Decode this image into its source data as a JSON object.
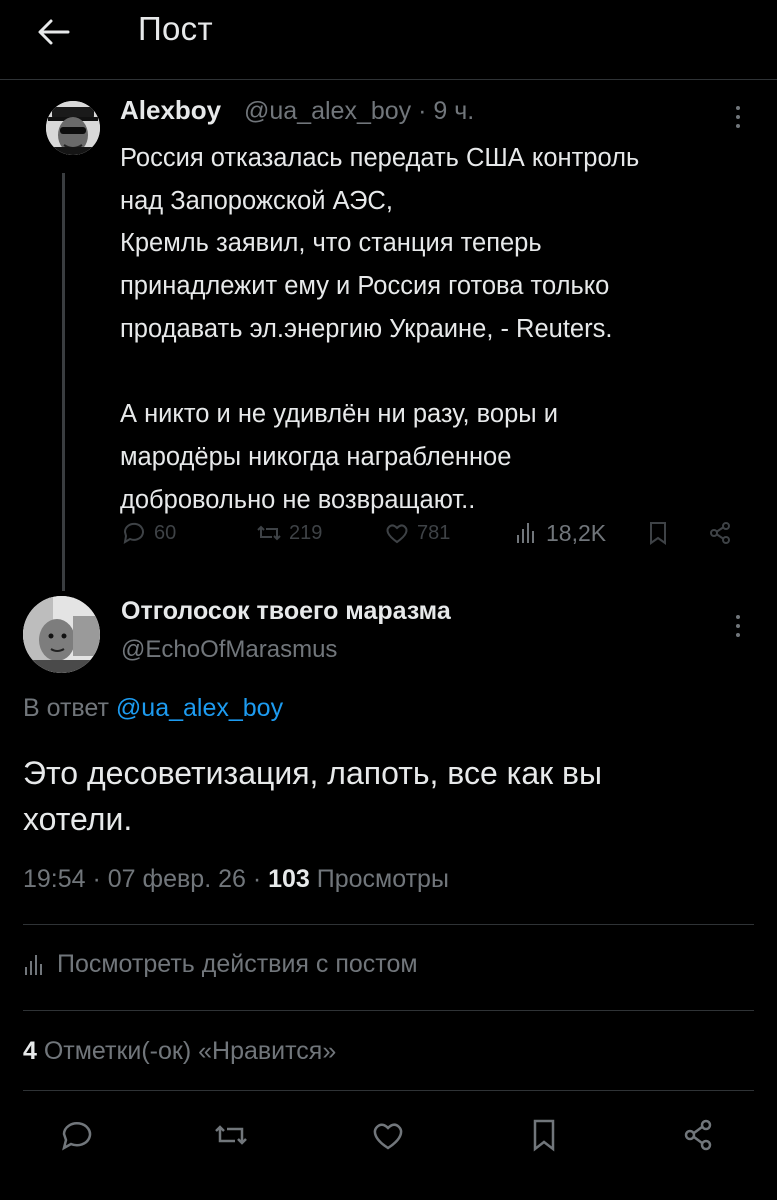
{
  "header": {
    "title": "Пост",
    "back_icon": "arrow-left-icon"
  },
  "parent_post": {
    "author_name": "Alexboy",
    "meta": "@ua_alex_boy · 9 ч.",
    "text_lines": [
      "Россия отказалась передать США контроль",
      "над Запорожской АЭС,",
      "Кремль заявил, что станция теперь",
      "принадлежит ему и Россия готова только",
      "продавать эл.энергию Украине, - Reuters."
    ],
    "text_lines_2": [
      "А никто и не удивлён ни разу, воры и",
      "мародёры никогда награбленное",
      "добровольно не возвращают.."
    ],
    "stats": {
      "replies": "60",
      "reposts": "219",
      "likes": "781",
      "views": "18,2K"
    }
  },
  "reply_post": {
    "author_name": "Отголосок твоего маразма",
    "handle": "@EchoOfMarasmus",
    "replying_prefix": "В ответ",
    "replying_mention": "@ua_alex_boy",
    "text_lines": [
      "Это десоветизация, лапоть, все как вы",
      "хотели."
    ],
    "time": "19:54 · 07 февр. 26 · ",
    "views_count": "103",
    "views_label": " Просмотры",
    "view_activity_label": "Посмотреть действия с постом",
    "likes_count": "4",
    "likes_label": " Отметки(-ок) «Нравится»"
  },
  "colors": {
    "background": "#000000",
    "text": "#e7e9ea",
    "muted": "#71767b",
    "accent": "#1d9bf0",
    "divider": "#2f3336"
  }
}
